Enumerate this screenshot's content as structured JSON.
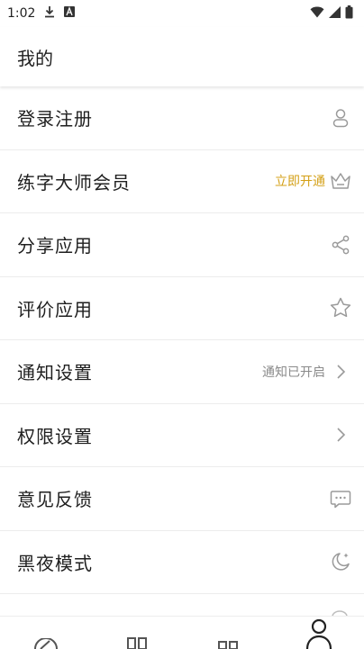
{
  "status_bar": {
    "time": "1:02",
    "icons": [
      "download-icon",
      "a-badge-icon",
      "wifi-icon",
      "signal-icon",
      "battery-icon"
    ]
  },
  "header": {
    "title": "我的"
  },
  "menu": [
    {
      "label": "登录注册",
      "value": "",
      "icon": "user-icon"
    },
    {
      "label": "练字大师会员",
      "value": "立即开通",
      "icon": "crown-icon"
    },
    {
      "label": "分享应用",
      "value": "",
      "icon": "share-icon"
    },
    {
      "label": "评价应用",
      "value": "",
      "icon": "star-icon"
    },
    {
      "label": "通知设置",
      "value": "通知已开启",
      "icon": "chevron-right-icon"
    },
    {
      "label": "权限设置",
      "value": "",
      "icon": "chevron-right-icon"
    },
    {
      "label": "意见反馈",
      "value": "",
      "icon": "chat-bubble-icon"
    },
    {
      "label": "黑夜模式",
      "value": "",
      "icon": "moon-icon"
    }
  ],
  "bottom_nav": {
    "items": [
      "brush-icon",
      "book-icon",
      "grid-icon",
      "profile-icon"
    ],
    "active": "profile-icon"
  },
  "colors": {
    "accent": "#d4a017",
    "text": "#1f1f1f",
    "muted": "#8a8a8a",
    "icon": "#9a9a9a"
  }
}
